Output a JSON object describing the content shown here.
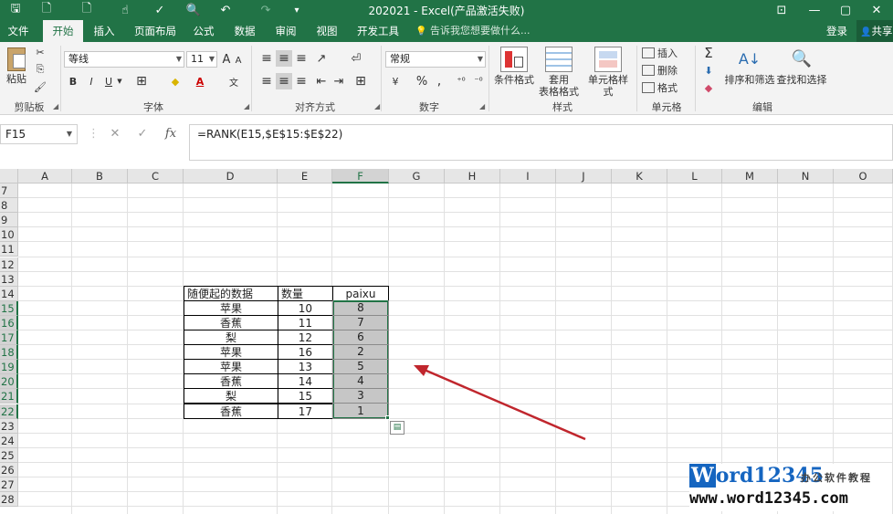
{
  "window": {
    "title": "202021 - Excel(产品激活失败)"
  },
  "tabs": [
    {
      "label": "文件"
    },
    {
      "label": "开始"
    },
    {
      "label": "插入"
    },
    {
      "label": "页面布局"
    },
    {
      "label": "公式"
    },
    {
      "label": "数据"
    },
    {
      "label": "审阅"
    },
    {
      "label": "视图"
    },
    {
      "label": "开发工具"
    }
  ],
  "tell_me": "告诉我您想要做什么...",
  "account": {
    "login": "登录",
    "share": "共享"
  },
  "ribbon": {
    "clipboard": {
      "paste": "粘贴",
      "label": "剪贴板"
    },
    "font": {
      "name": "等线",
      "size": "11",
      "label": "字体",
      "bold": "B",
      "italic": "I",
      "underline": "U"
    },
    "alignment": {
      "label": "对齐方式"
    },
    "number": {
      "format": "常规",
      "label": "数字",
      "percent": "%"
    },
    "styles": {
      "conditional": "条件格式",
      "table_line1": "套用",
      "table_line2": "表格格式",
      "cell_styles": "单元格样式",
      "label": "样式"
    },
    "cells": {
      "insert": "插入",
      "delete": "删除",
      "format": "格式",
      "label": "单元格"
    },
    "editing": {
      "sort": "排序和筛选",
      "find": "查找和选择",
      "label": "编辑"
    }
  },
  "formula_bar": {
    "name_box": "F15",
    "formula": "=RANK(E15,$E$15:$E$22)"
  },
  "columns": [
    "A",
    "B",
    "C",
    "D",
    "E",
    "F",
    "G",
    "H",
    "I",
    "J",
    "K",
    "L",
    "M",
    "N",
    "O"
  ],
  "rows": [
    "7",
    "8",
    "9",
    "10",
    "11",
    "12",
    "13",
    "14",
    "15",
    "16",
    "17",
    "18",
    "19",
    "20",
    "21",
    "22",
    "23",
    "24",
    "25",
    "26",
    "27",
    "28"
  ],
  "table": {
    "headers": [
      "随便起的数据",
      "数量",
      "paixu"
    ],
    "rows": [
      {
        "name": "苹果",
        "qty": "10",
        "rank": "8"
      },
      {
        "name": "香蕉",
        "qty": "11",
        "rank": "7"
      },
      {
        "name": "梨",
        "qty": "12",
        "rank": "6"
      },
      {
        "name": "苹果",
        "qty": "16",
        "rank": "2"
      },
      {
        "name": "苹果",
        "qty": "13",
        "rank": "5"
      },
      {
        "name": "香蕉",
        "qty": "14",
        "rank": "4"
      },
      {
        "name": "梨",
        "qty": "15",
        "rank": "3"
      },
      {
        "name": "香蕉",
        "qty": "17",
        "rank": "1"
      }
    ]
  },
  "watermark": {
    "logo_w": "W",
    "logo_rest": "ord12345",
    "tagline": "办公软件教程",
    "url": "www.word12345.com"
  },
  "colors": {
    "excel_green": "#217346",
    "arrow_red": "#c0262d",
    "selection_gray": "#c6c6c6"
  },
  "icons": [
    "save-icon",
    "new-file-icon",
    "touch-mode-icon",
    "spell-check-icon",
    "print-preview-icon",
    "undo-icon",
    "redo-icon",
    "customize-icon",
    "ribbon-display-icon",
    "minimize-icon",
    "maximize-icon",
    "close-icon",
    "lightbulb-icon",
    "user-icon",
    "cancel-icon",
    "confirm-icon",
    "insert-function-icon",
    "paste-options-icon",
    "arrow-annotation"
  ],
  "glyphs": {
    "save": "🖫",
    "new": "🗋",
    "touch": "☝",
    "spell": "✓",
    "preview": "🔍",
    "undo": "↶",
    "redo": "↷",
    "more": "▾",
    "ribbon_opts": "⊡",
    "min": "—",
    "max": "▢",
    "close": "✕",
    "cut": "✂",
    "copy": "⎘",
    "brush": "🖌",
    "grow": "A",
    "shrink": "A",
    "fill": "◆",
    "fontcolor": "A",
    "border": "⊞",
    "wen": "文",
    "align_top": "≡",
    "align_mid": "≡",
    "align_bot": "≡",
    "orient": "↗",
    "wrap": "⏎",
    "left": "≡",
    "center": "≡",
    "right": "≡",
    "dec_ind": "⇤",
    "inc_ind": "⇥",
    "merge": "⊞",
    "currency": "¥",
    "comma": ",",
    "inc_dec": "⁺⁰",
    "dec_dec": "⁻⁰",
    "sigma": "Σ",
    "fill_down": "⬇",
    "clear": "◆",
    "cancel": "✕",
    "enter": "✓",
    "fx": "fx",
    "paste_opts": "▤",
    "launcher": "◢",
    "bulb": "💡",
    "user": "👤"
  }
}
